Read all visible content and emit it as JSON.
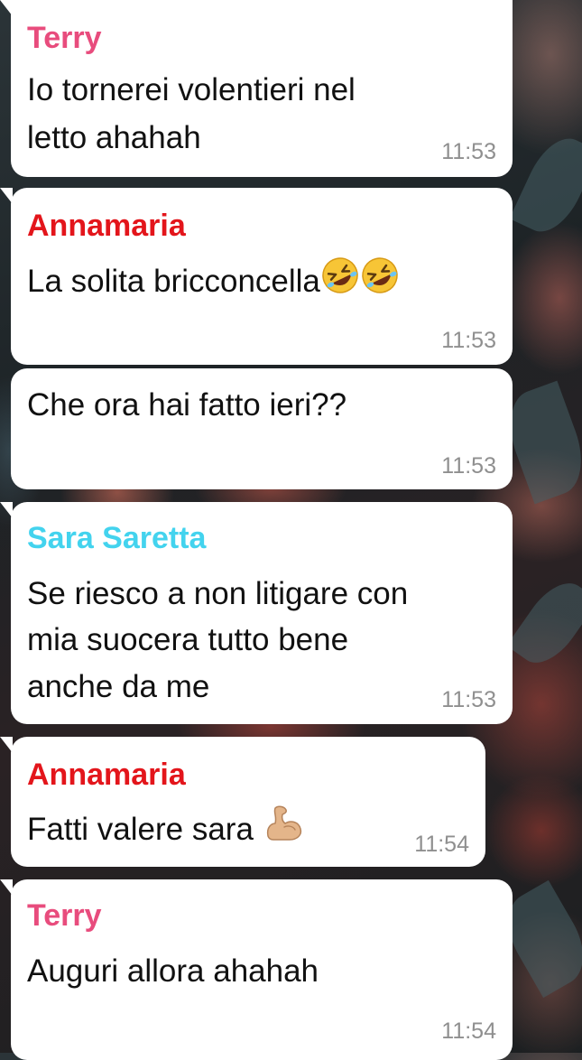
{
  "colors": {
    "terry": "#e84c7d",
    "annamaria": "#e3151b",
    "sara": "#43d3ee",
    "bubble": "#ffffff",
    "text": "#111111",
    "time": "#8f8f8f"
  },
  "messages": [
    {
      "sender": "Terry",
      "lines": [
        "Io tornerei volentieri nel",
        "letto ahahah"
      ],
      "time": "11:53"
    },
    {
      "sender": "Annamaria",
      "lines": [
        "La solita bricconcella"
      ],
      "emoji": [
        "rolling-on-floor-laughing",
        "rolling-on-floor-laughing"
      ],
      "time": "11:53"
    },
    {
      "sender": "",
      "lines": [
        "Che ora hai fatto ieri??"
      ],
      "time": "11:53"
    },
    {
      "sender": "Sara Saretta",
      "lines": [
        "Se riesco a non litigare con",
        "mia suocera tutto bene",
        "anche da me"
      ],
      "time": "11:53"
    },
    {
      "sender": "Annamaria",
      "lines": [
        "Fatti valere sara "
      ],
      "emoji": [
        "flexed-biceps"
      ],
      "time": "11:54"
    },
    {
      "sender": "Terry",
      "lines": [
        "Auguri allora ahahah"
      ],
      "time": "11:54"
    }
  ]
}
